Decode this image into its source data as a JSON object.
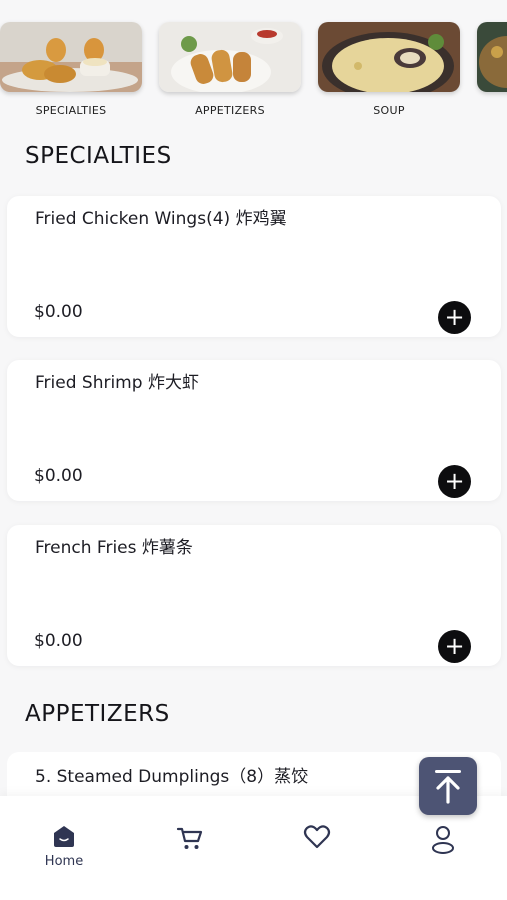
{
  "categories": [
    {
      "label": "SPECIALTIES"
    },
    {
      "label": "APPETIZERS"
    },
    {
      "label": "SOUP"
    },
    {
      "label": ""
    }
  ],
  "sections": [
    {
      "title": "SPECIALTIES",
      "items": [
        {
          "name": "Fried Chicken Wings(4) 炸鸡翼",
          "price": "$0.00"
        },
        {
          "name": "Fried Shrimp 炸大虾",
          "price": "$0.00"
        },
        {
          "name": "French Fries 炸薯条",
          "price": "$0.00"
        }
      ]
    },
    {
      "title": "APPETIZERS",
      "items": [
        {
          "name": "5. Steamed Dumplings（8）蒸饺"
        }
      ]
    }
  ],
  "bottom_nav": {
    "items": [
      {
        "label": "Home",
        "icon": "home-icon",
        "active": true
      },
      {
        "label": "",
        "icon": "cart-icon"
      },
      {
        "label": "",
        "icon": "heart-icon"
      },
      {
        "label": "",
        "icon": "user-icon"
      }
    ]
  },
  "colors": {
    "accent": "#4d5474",
    "add_button": "#0d0d0f",
    "background": "#f7f7f8"
  }
}
